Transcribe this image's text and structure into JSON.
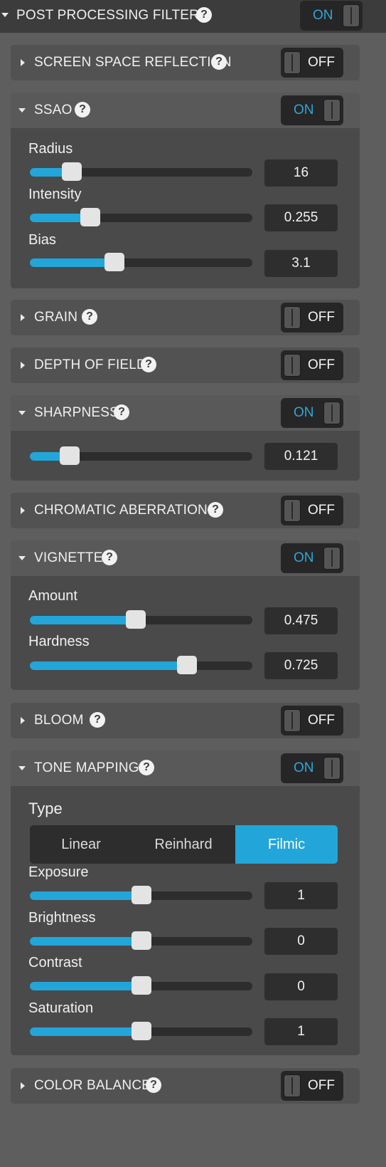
{
  "header": {
    "title": "POST PROCESSING FILTERS",
    "toggle": "ON"
  },
  "help_glyph": "?",
  "sections": {
    "ssr": {
      "title": "SCREEN SPACE REFLECTION",
      "toggle": "OFF"
    },
    "ssao": {
      "title": "SSAO",
      "toggle": "ON",
      "radius": {
        "label": "Radius",
        "value": "16",
        "fraction": 0.19
      },
      "intensity": {
        "label": "Intensity",
        "value": "0.255",
        "fraction": 0.27
      },
      "bias": {
        "label": "Bias",
        "value": "3.1",
        "fraction": 0.38
      }
    },
    "grain": {
      "title": "GRAIN",
      "toggle": "OFF"
    },
    "dof": {
      "title": "DEPTH OF FIELD",
      "toggle": "OFF"
    },
    "sharpness": {
      "title": "SHARPNESS",
      "toggle": "ON",
      "amount": {
        "value": "0.121",
        "fraction": 0.18
      }
    },
    "chromatic": {
      "title": "CHROMATIC ABERRATIONS",
      "toggle": "OFF"
    },
    "vignette": {
      "title": "VIGNETTE",
      "toggle": "ON",
      "amount": {
        "label": "Amount",
        "value": "0.475",
        "fraction": 0.475
      },
      "hardness": {
        "label": "Hardness",
        "value": "0.725",
        "fraction": 0.705
      }
    },
    "bloom": {
      "title": "BLOOM",
      "toggle": "OFF"
    },
    "tone": {
      "title": "TONE MAPPING",
      "toggle": "ON",
      "type_label": "Type",
      "options": [
        "Linear",
        "Reinhard",
        "Filmic"
      ],
      "selected": "Filmic",
      "exposure": {
        "label": "Exposure",
        "value": "1",
        "fraction": 0.5
      },
      "brightness": {
        "label": "Brightness",
        "value": "0",
        "fraction": 0.5
      },
      "contrast": {
        "label": "Contrast",
        "value": "0",
        "fraction": 0.5
      },
      "saturation": {
        "label": "Saturation",
        "value": "1",
        "fraction": 0.5
      }
    },
    "color_balance": {
      "title": "COLOR BALANCE",
      "toggle": "OFF"
    }
  },
  "colors": {
    "accent": "#22a6d9",
    "on_text": "#33a5d6",
    "panel": "#4e4e4e",
    "background": "#5e5e5e"
  }
}
